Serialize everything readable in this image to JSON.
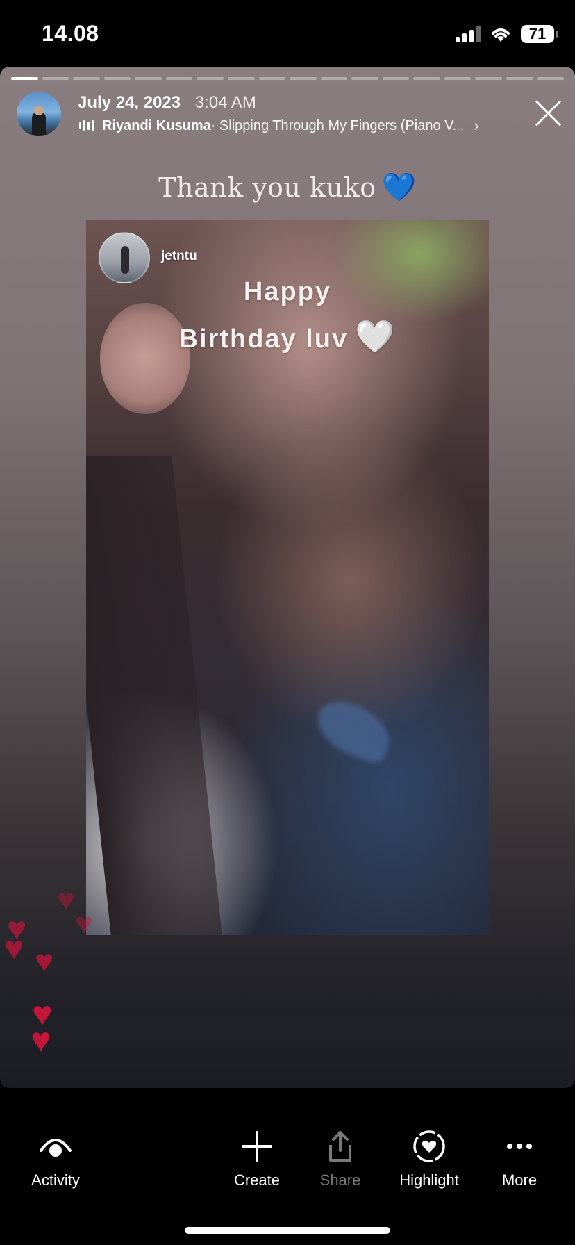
{
  "status": {
    "time": "14.08",
    "battery": "71"
  },
  "header": {
    "date": "July 24, 2023",
    "time": "3:04 AM",
    "artist": "Riyandi Kusuma",
    "song": " · Slipping Through My Fingers (Piano V...",
    "progress_segments": 18,
    "progress_current": 1
  },
  "story": {
    "caption": "Thank you kuko",
    "caption_emoji": "💙",
    "reshared": {
      "username": "jetntu",
      "text_line1": "Happy",
      "text_line2": "Birthday luv",
      "text_emoji": "🤍"
    }
  },
  "tabs": [
    {
      "label": "Activity",
      "icon": "eye-icon",
      "enabled": true
    },
    {
      "label": "Create",
      "icon": "plus-icon",
      "enabled": true
    },
    {
      "label": "Share",
      "icon": "share-icon",
      "enabled": false
    },
    {
      "label": "Highlight",
      "icon": "highlight-heart-icon",
      "enabled": true
    },
    {
      "label": "More",
      "icon": "more-icon",
      "enabled": true
    }
  ],
  "colors": {
    "heart_red": "#c4163a",
    "heart_blue": "#2f8fe8"
  }
}
